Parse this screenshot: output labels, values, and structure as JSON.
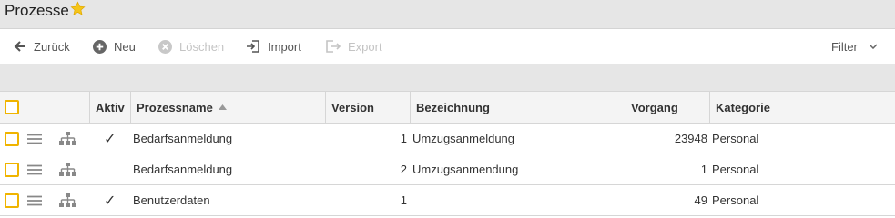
{
  "page": {
    "title": "Prozesse"
  },
  "toolbar": {
    "back": "Zurück",
    "new": "Neu",
    "delete": "Löschen",
    "import": "Import",
    "export": "Export",
    "filter": "Filter"
  },
  "table": {
    "headers": {
      "aktiv": "Aktiv",
      "name": "Prozessname",
      "version": "Version",
      "bezeichnung": "Bezeichnung",
      "vorgang": "Vorgang",
      "kategorie": "Kategorie"
    },
    "sort": {
      "column": "Prozessname",
      "direction": "ascending"
    },
    "rows": [
      {
        "aktiv": "✓",
        "name": "Bedarfsanmeldung",
        "version": "1",
        "bezeichnung": "Umzugsanmeldung",
        "vorgang": "23948",
        "kategorie": "Personal"
      },
      {
        "aktiv": "",
        "name": "Bedarfsanmeldung",
        "version": "2",
        "bezeichnung": "Umzugsanmendung",
        "vorgang": "1",
        "kategorie": "Personal"
      },
      {
        "aktiv": "✓",
        "name": "Benutzerdaten",
        "version": "1",
        "bezeichnung": "",
        "vorgang": "49",
        "kategorie": "Personal"
      }
    ]
  },
  "colors": {
    "accent": "#f0b400",
    "star": "#f5c518"
  },
  "icons": {
    "favorite": "star-icon",
    "back": "arrow-left-icon",
    "new": "plus-circle-icon",
    "delete": "x-circle-icon",
    "import": "import-icon",
    "export": "export-icon",
    "filter": "chevron-down-icon",
    "row_drag": "drag-handle-icon",
    "row_tree": "hierarchy-icon"
  }
}
